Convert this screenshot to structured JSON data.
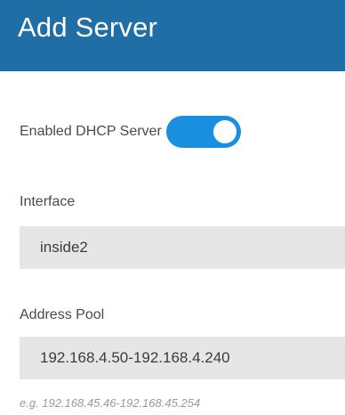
{
  "header": {
    "title": "Add Server",
    "background": "#1f6fa6"
  },
  "dhcp": {
    "label": "Enabled DHCP Server",
    "enabled": true,
    "toggle_color": "#1a8fe0"
  },
  "interface": {
    "label": "Interface",
    "value": "inside2"
  },
  "address_pool": {
    "label": "Address Pool",
    "value": "192.168.4.50-192.168.4.240",
    "hint": "e.g. 192.168.45.46-192.168.45.254"
  }
}
